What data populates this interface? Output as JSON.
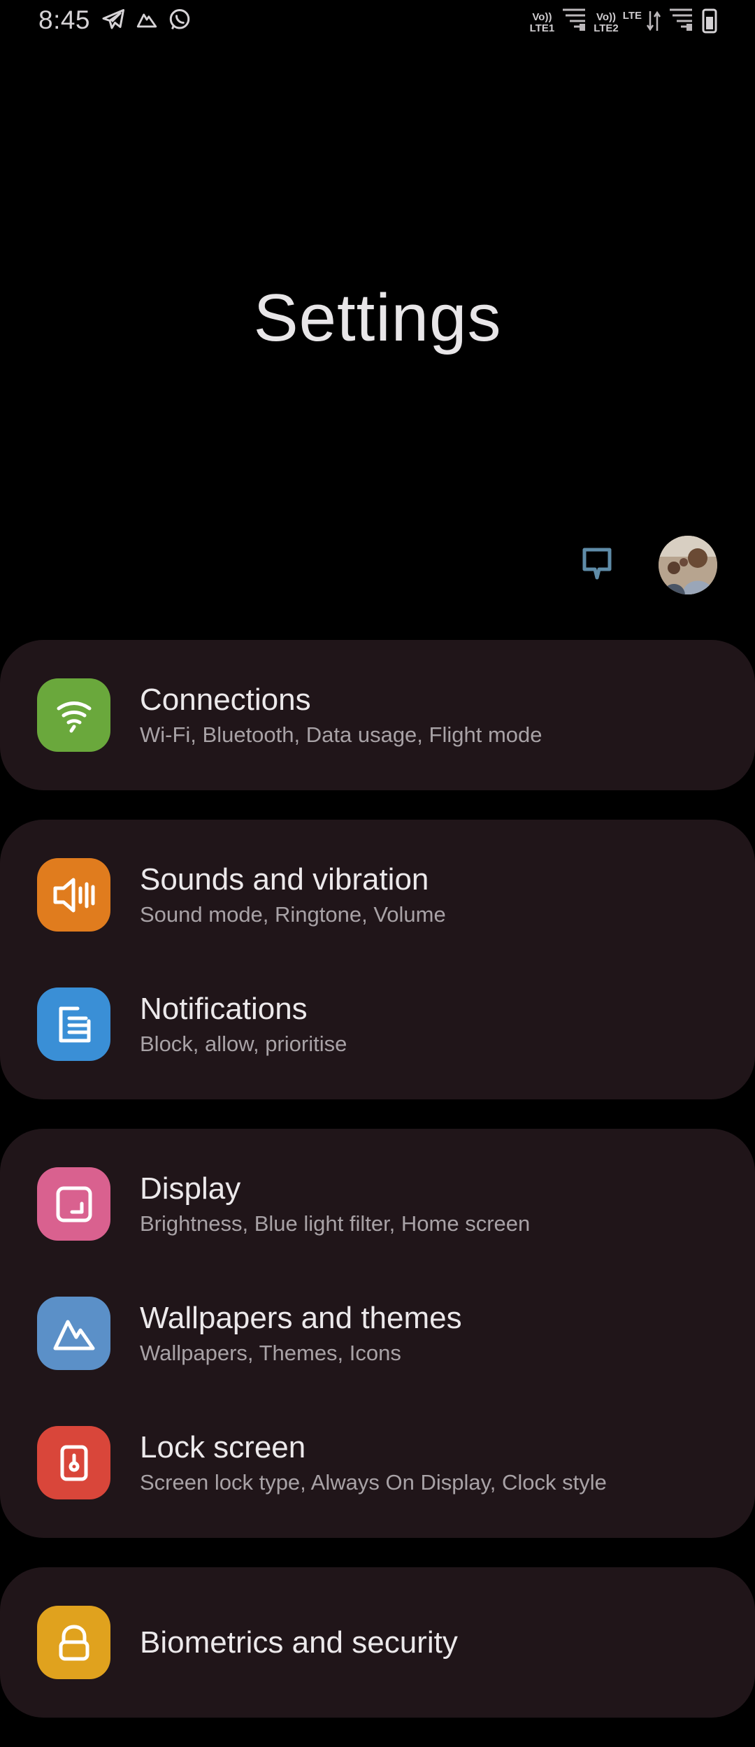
{
  "status_bar": {
    "time": "8:45",
    "sim1_top": "Vo))",
    "sim1_bottom": "LTE1",
    "sim2_top": "Vo))",
    "sim2_bottom": "LTE2",
    "lte_label": "LTE",
    "icons": [
      "telegram-icon",
      "drive-icon",
      "whatsapp-icon",
      "signal-icon",
      "data-activity-icon",
      "battery-icon"
    ]
  },
  "header": {
    "title": "Settings"
  },
  "settings": {
    "groups": [
      {
        "items": [
          {
            "title": "Connections",
            "subtitle": "Wi-Fi, Bluetooth, Data usage, Flight mode",
            "icon": "wifi-icon",
            "color": "#6aa83c"
          }
        ]
      },
      {
        "items": [
          {
            "title": "Sounds and vibration",
            "subtitle": "Sound mode, Ringtone, Volume",
            "icon": "speaker-icon",
            "color": "#e07c1e"
          },
          {
            "title": "Notifications",
            "subtitle": "Block, allow, prioritise",
            "icon": "notifications-icon",
            "color": "#3a8fd6"
          }
        ]
      },
      {
        "items": [
          {
            "title": "Display",
            "subtitle": "Brightness, Blue light filter, Home screen",
            "icon": "display-icon",
            "color": "#d9618f"
          },
          {
            "title": "Wallpapers and themes",
            "subtitle": "Wallpapers, Themes, Icons",
            "icon": "wallpaper-icon",
            "color": "#5b90c8"
          },
          {
            "title": "Lock screen",
            "subtitle": "Screen lock type, Always On Display, Clock style",
            "icon": "lock-screen-icon",
            "color": "#d9463a"
          }
        ]
      },
      {
        "items": [
          {
            "title": "Biometrics and security",
            "subtitle": "",
            "icon": "biometrics-icon",
            "color": "#e0a21e"
          }
        ]
      }
    ]
  }
}
